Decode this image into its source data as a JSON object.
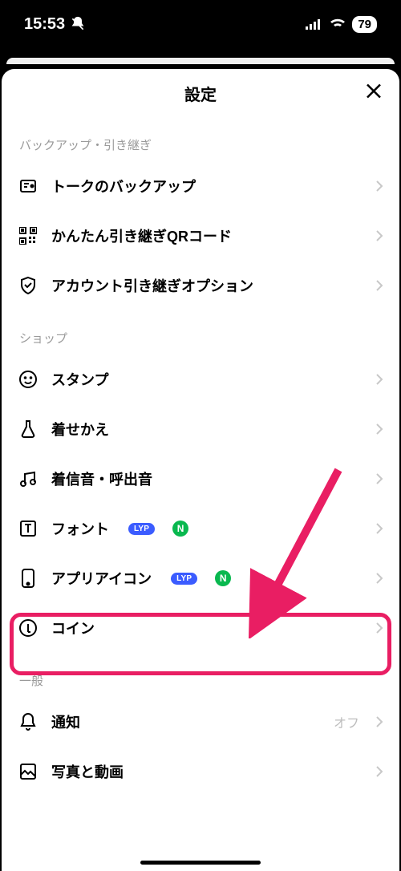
{
  "status": {
    "time": "15:53",
    "battery": "79"
  },
  "header": {
    "title": "設定"
  },
  "sections": {
    "backup": {
      "header": "バックアップ・引き継ぎ",
      "items": {
        "talk_backup": "トークのバックアップ",
        "qr_transfer": "かんたん引き継ぎQRコード",
        "account_transfer": "アカウント引き継ぎオプション"
      }
    },
    "shop": {
      "header": "ショップ",
      "items": {
        "stamps": "スタンプ",
        "themes": "着せかえ",
        "ringtones": "着信音・呼出音",
        "font": "フォント",
        "app_icon": "アプリアイコン",
        "coins": "コイン"
      }
    },
    "general": {
      "header": "一般",
      "items": {
        "notifications": "通知",
        "photos": "写真と動画"
      },
      "notifications_status": "オフ"
    }
  },
  "badges": {
    "lyp": "LYP",
    "n": "N"
  }
}
